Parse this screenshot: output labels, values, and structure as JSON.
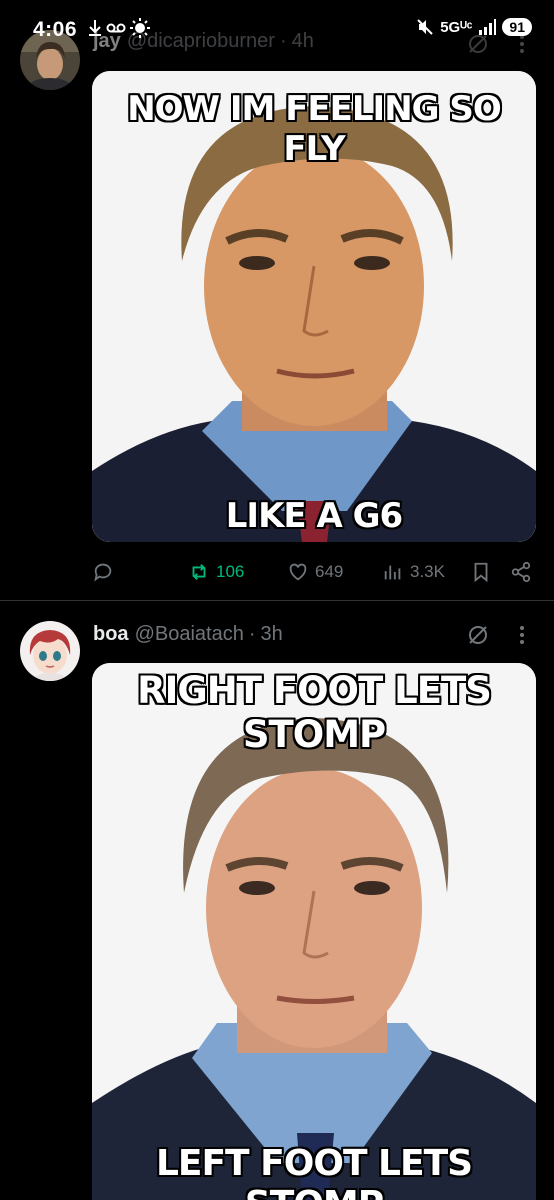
{
  "status_bar": {
    "time": "4:06",
    "left_icons": [
      "download-icon",
      "voicemail-icon",
      "brightness-icon"
    ],
    "network": "5Gᵁᶜ",
    "battery": "91"
  },
  "posts": [
    {
      "name": "jay",
      "handle": "@dicaprioburner",
      "time": "4h",
      "meme_top": "NOW IM FEELING SO FLY",
      "meme_bottom": "LIKE A G6",
      "reposts": "106",
      "likes": "649",
      "views": "3.3K"
    },
    {
      "name": "boa",
      "handle": "@Boaiatach",
      "time": "3h",
      "meme_top": "RIGHT FOOT LETS STOMP",
      "meme_bottom": "LEFT FOOT LETS STOMP"
    }
  ],
  "colors": {
    "background": "#000000",
    "text": "#e7e9ea",
    "muted": "#71767b",
    "repost_green": "#00ba7c",
    "divider": "#2f3336"
  }
}
